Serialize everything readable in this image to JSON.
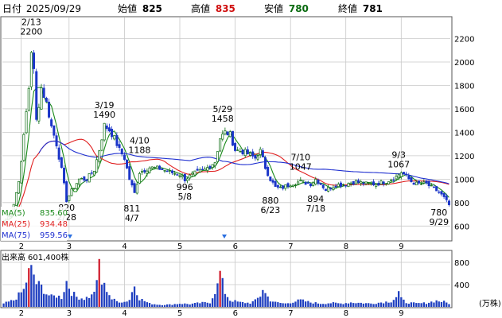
{
  "header": {
    "date_label": "日付",
    "date": "2025/09/29",
    "open_label": "始値",
    "open": "825",
    "high_label": "高値",
    "high": "835",
    "low_label": "安値",
    "low": "780",
    "close_label": "終値",
    "close": "781"
  },
  "colors": {
    "up": "#0a6b10",
    "down": "#1a35c8",
    "high": "#d01010",
    "low": "#0a6b10",
    "ma5": "#1a8a1a",
    "ma25": "#e02020",
    "ma75": "#2030d0",
    "volume": "#2040c0",
    "volume_peak": "#d02030",
    "grid": "#c8c8c8",
    "marker": "#2a6fe0"
  },
  "legend": [
    {
      "label": "MA(5)",
      "value": "835.60",
      "color": "#1a8a1a"
    },
    {
      "label": "MA(25)",
      "value": "934.48",
      "color": "#e02020"
    },
    {
      "label": "MA(75)",
      "value": "959.56",
      "color": "#2030d0"
    }
  ],
  "volume_label": "出来高",
  "volume_value": "601,400株",
  "volume_unit": "(万株)",
  "chart_data": {
    "type": "candlestick",
    "price_axis": {
      "ticks": [
        600,
        800,
        1000,
        1200,
        1400,
        1600,
        1800,
        2000,
        2200
      ],
      "ylim": [
        480,
        2380
      ]
    },
    "volume_axis": {
      "ticks": [
        400,
        800
      ],
      "ylim": [
        0,
        1000
      ]
    },
    "month_ticks": [
      "2",
      "3",
      "4",
      "5",
      "6",
      "7",
      "8",
      "9"
    ],
    "month_tick_index": [
      7,
      26,
      48,
      70,
      92,
      114,
      136,
      158
    ],
    "n_days": 178,
    "close_keyframes": [
      [
        0,
        640
      ],
      [
        3,
        700
      ],
      [
        6,
        980
      ],
      [
        8,
        1360
      ],
      [
        10,
        1780
      ],
      [
        11,
        2100
      ],
      [
        12,
        1920
      ],
      [
        13,
        1500
      ],
      [
        15,
        1780
      ],
      [
        17,
        1650
      ],
      [
        19,
        1450
      ],
      [
        21,
        1300
      ],
      [
        23,
        1080
      ],
      [
        25,
        820
      ],
      [
        27,
        900
      ],
      [
        30,
        1000
      ],
      [
        33,
        1000
      ],
      [
        36,
        1080
      ],
      [
        38,
        1250
      ],
      [
        40,
        1460
      ],
      [
        42,
        1420
      ],
      [
        44,
        1350
      ],
      [
        46,
        1250
      ],
      [
        48,
        1180
      ],
      [
        50,
        1000
      ],
      [
        52,
        880
      ],
      [
        54,
        1060
      ],
      [
        56,
        1080
      ],
      [
        58,
        1100
      ],
      [
        62,
        1090
      ],
      [
        66,
        1060
      ],
      [
        70,
        1040
      ],
      [
        72,
        1000
      ],
      [
        76,
        1050
      ],
      [
        80,
        1080
      ],
      [
        84,
        1150
      ],
      [
        86,
        1350
      ],
      [
        88,
        1400
      ],
      [
        90,
        1380
      ],
      [
        92,
        1250
      ],
      [
        96,
        1230
      ],
      [
        100,
        1180
      ],
      [
        102,
        1240
      ],
      [
        104,
        1100
      ],
      [
        106,
        1000
      ],
      [
        108,
        930
      ],
      [
        110,
        920
      ],
      [
        114,
        960
      ],
      [
        118,
        980
      ],
      [
        122,
        960
      ],
      [
        124,
        1000
      ],
      [
        126,
        960
      ],
      [
        128,
        910
      ],
      [
        132,
        950
      ],
      [
        136,
        960
      ],
      [
        140,
        980
      ],
      [
        144,
        960
      ],
      [
        148,
        960
      ],
      [
        152,
        980
      ],
      [
        156,
        1020
      ],
      [
        158,
        1060
      ],
      [
        160,
        1020
      ],
      [
        162,
        980
      ],
      [
        164,
        960
      ],
      [
        168,
        960
      ],
      [
        170,
        930
      ],
      [
        173,
        890
      ],
      [
        175,
        840
      ],
      [
        177,
        781
      ]
    ],
    "annotations": [
      {
        "date": "2/13",
        "price": "2200",
        "index": 11,
        "pos": "above",
        "anchor": 2200
      },
      {
        "date": "2/28",
        "price": "820",
        "index": 25,
        "pos": "below",
        "anchor": 820
      },
      {
        "date": "3/19",
        "price": "1490",
        "index": 40,
        "pos": "above",
        "anchor": 1490
      },
      {
        "date": "4/7",
        "price": "811",
        "index": 51,
        "pos": "below",
        "anchor": 811
      },
      {
        "date": "4/10",
        "price": "1188",
        "index": 54,
        "pos": "above",
        "anchor": 1188
      },
      {
        "date": "5/8",
        "price": "996",
        "index": 72,
        "pos": "below",
        "anchor": 996
      },
      {
        "date": "5/29",
        "price": "1458",
        "index": 87,
        "pos": "above",
        "anchor": 1458
      },
      {
        "date": "6/23",
        "price": "880",
        "index": 106,
        "pos": "below",
        "anchor": 880
      },
      {
        "date": "7/10",
        "price": "1047",
        "index": 118,
        "pos": "above",
        "anchor": 1047
      },
      {
        "date": "7/18",
        "price": "894",
        "index": 124,
        "pos": "below",
        "anchor": 894
      },
      {
        "date": "9/3",
        "price": "1067",
        "index": 157,
        "pos": "above",
        "anchor": 1067
      },
      {
        "date": "9/29",
        "price": "780",
        "index": 173,
        "pos": "below",
        "anchor": 780
      }
    ],
    "volume_keyframes": [
      [
        0,
        60
      ],
      [
        4,
        120
      ],
      [
        8,
        300
      ],
      [
        10,
        620
      ],
      [
        11,
        660
      ],
      [
        12,
        580
      ],
      [
        13,
        420
      ],
      [
        15,
        360
      ],
      [
        17,
        240
      ],
      [
        19,
        180
      ],
      [
        21,
        200
      ],
      [
        23,
        170
      ],
      [
        25,
        460
      ],
      [
        27,
        260
      ],
      [
        29,
        180
      ],
      [
        32,
        150
      ],
      [
        35,
        200
      ],
      [
        37,
        400
      ],
      [
        38,
        820
      ],
      [
        39,
        420
      ],
      [
        41,
        320
      ],
      [
        43,
        140
      ],
      [
        45,
        100
      ],
      [
        48,
        90
      ],
      [
        50,
        130
      ],
      [
        52,
        400
      ],
      [
        54,
        150
      ],
      [
        58,
        60
      ],
      [
        62,
        40
      ],
      [
        66,
        40
      ],
      [
        70,
        60
      ],
      [
        74,
        50
      ],
      [
        78,
        70
      ],
      [
        82,
        80
      ],
      [
        85,
        380
      ],
      [
        86,
        620
      ],
      [
        87,
        420
      ],
      [
        88,
        260
      ],
      [
        90,
        120
      ],
      [
        94,
        80
      ],
      [
        98,
        70
      ],
      [
        100,
        110
      ],
      [
        102,
        200
      ],
      [
        103,
        330
      ],
      [
        104,
        240
      ],
      [
        106,
        120
      ],
      [
        108,
        80
      ],
      [
        112,
        60
      ],
      [
        116,
        100
      ],
      [
        118,
        120
      ],
      [
        122,
        80
      ],
      [
        126,
        60
      ],
      [
        130,
        70
      ],
      [
        134,
        60
      ],
      [
        138,
        80
      ],
      [
        142,
        70
      ],
      [
        146,
        60
      ],
      [
        150,
        80
      ],
      [
        154,
        100
      ],
      [
        156,
        180
      ],
      [
        157,
        260
      ],
      [
        158,
        140
      ],
      [
        160,
        80
      ],
      [
        164,
        60
      ],
      [
        168,
        70
      ],
      [
        172,
        110
      ],
      [
        175,
        90
      ],
      [
        177,
        60
      ]
    ],
    "volume_peaks": [
      10,
      38,
      86
    ]
  }
}
